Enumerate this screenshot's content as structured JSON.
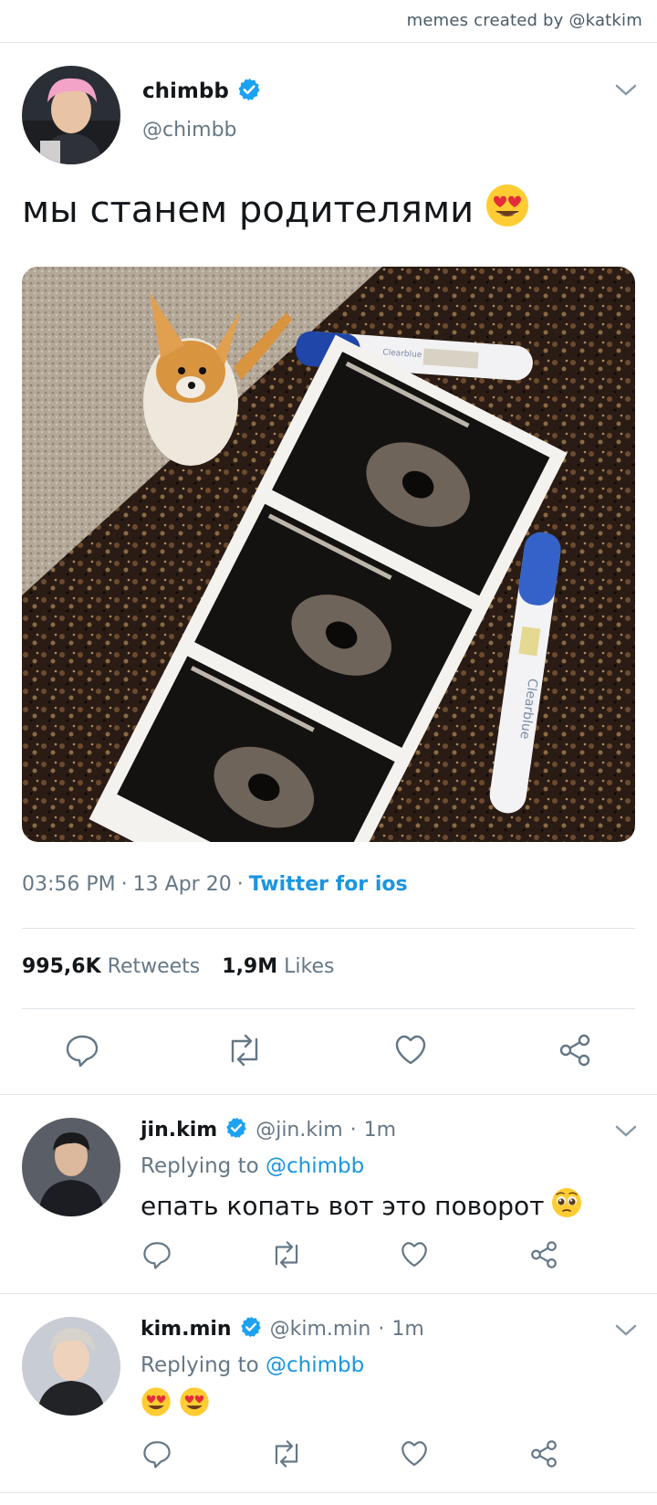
{
  "watermark": "memes created by @katkim",
  "main_tweet": {
    "name": "chimbb",
    "handle": "@chimbb",
    "text": "мы станем родителями",
    "text_emoji": "heart-eyes-emoji",
    "time": "03:56 PM",
    "date": "13 Apr 20",
    "source": "Twitter for ios",
    "retweets_count": "995,6K",
    "retweets_label": "Retweets",
    "likes_count": "1,9M",
    "likes_label": "Likes",
    "photo_alt_items": [
      "dog",
      "pregnancy-test",
      "ultrasound-strip",
      "pregnancy-test"
    ],
    "photo_brand_text": "Clearblue"
  },
  "replies": [
    {
      "name": "jin.kim",
      "handle": "@jin.kim",
      "time": "1m",
      "replying_prefix": "Replying to",
      "replying_to": "@chimbb",
      "text": "епать копать вот это поворот",
      "emoji": "pleading-face-emoji"
    },
    {
      "name": "kim.min",
      "handle": "@kim.min",
      "time": "1m",
      "replying_prefix": "Replying to",
      "replying_to": "@chimbb",
      "text": "",
      "emoji": "heart-eyes-emoji-x2"
    }
  ],
  "colors": {
    "accent": "#1b95e0",
    "secondary_text": "#657786",
    "divider": "#dfe5ea",
    "verified": "#1da1f2"
  },
  "icons": [
    "reply-icon",
    "retweet-icon",
    "like-icon",
    "share-icon",
    "chevron-down-icon",
    "verified-badge-icon"
  ]
}
